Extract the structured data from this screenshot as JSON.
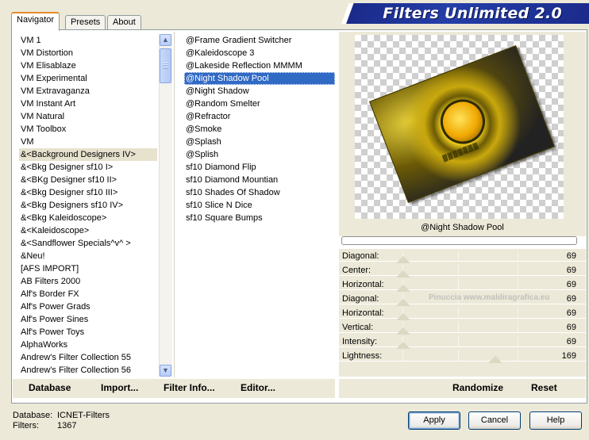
{
  "app_title": "Filters Unlimited 2.0",
  "tabs": [
    {
      "label": "Navigator",
      "active": true
    },
    {
      "label": "Presets",
      "active": false
    },
    {
      "label": "About",
      "active": false
    }
  ],
  "categories": [
    {
      "label": "VM 1"
    },
    {
      "label": "VM Distortion"
    },
    {
      "label": "VM Elisablaze"
    },
    {
      "label": "VM Experimental"
    },
    {
      "label": "VM Extravaganza"
    },
    {
      "label": "VM Instant Art"
    },
    {
      "label": "VM Natural"
    },
    {
      "label": "VM Toolbox"
    },
    {
      "label": "VM"
    },
    {
      "label": "&<Background Designers IV>",
      "selected": true
    },
    {
      "label": "&<Bkg Designer sf10 I>"
    },
    {
      "label": "&<BKg Designer sf10 II>"
    },
    {
      "label": "&<Bkg Designer sf10 III>"
    },
    {
      "label": "&<Bkg Designers sf10 IV>"
    },
    {
      "label": "&<Bkg Kaleidoscope>"
    },
    {
      "label": "&<Kaleidoscope>"
    },
    {
      "label": "&<Sandflower Specials^v^ >"
    },
    {
      "label": "&Neu!"
    },
    {
      "label": "[AFS IMPORT]"
    },
    {
      "label": "AB Filters 2000"
    },
    {
      "label": "Alf's Border FX"
    },
    {
      "label": "Alf's Power Grads"
    },
    {
      "label": "Alf's Power Sines"
    },
    {
      "label": "Alf's Power Toys"
    },
    {
      "label": "AlphaWorks"
    },
    {
      "label": "Andrew's Filter Collection 55"
    },
    {
      "label": "Andrew's Filter Collection 56"
    }
  ],
  "filters": [
    {
      "label": "@Frame Gradient Switcher"
    },
    {
      "label": "@Kaleidoscope 3"
    },
    {
      "label": "@Lakeside Reflection MMMM"
    },
    {
      "label": "@Night Shadow Pool",
      "selected": true
    },
    {
      "label": "@Night Shadow"
    },
    {
      "label": "@Random Smelter"
    },
    {
      "label": "@Refractor"
    },
    {
      "label": "@Smoke"
    },
    {
      "label": "@Splash"
    },
    {
      "label": "@Splish"
    },
    {
      "label": "sf10 Diamond Flip"
    },
    {
      "label": "sf10 Diamond Mountian"
    },
    {
      "label": "sf10 Shades Of Shadow"
    },
    {
      "label": "sf10 Slice N Dice"
    },
    {
      "label": "sf10 Square Bumps"
    }
  ],
  "preview": {
    "filter_name": "@Night Shadow Pool",
    "image_text": "▓▓▓▓▓▓▓",
    "progress": 0
  },
  "parameters": [
    {
      "label": "Diagonal:",
      "value": "69"
    },
    {
      "label": "Center:",
      "value": "69"
    },
    {
      "label": "Horizontal:",
      "value": "69"
    },
    {
      "label": "Diagonal:",
      "value": "69"
    },
    {
      "label": "Horizontal:",
      "value": "69"
    },
    {
      "label": "Vertical:",
      "value": "69"
    },
    {
      "label": "Intensity:",
      "value": "69"
    },
    {
      "label": "Lightness:",
      "value": "169"
    }
  ],
  "watermark": "Pinuccia www.maldiragrafica.eu",
  "left_buttons": {
    "database": "Database",
    "import": "Import...",
    "filter_info": "Filter Info...",
    "editor": "Editor..."
  },
  "right_buttons": {
    "randomize": "Randomize",
    "reset": "Reset"
  },
  "status": {
    "database_label": "Database:",
    "database_value": "ICNET-Filters",
    "filters_label": "Filters:",
    "filters_value": "1367"
  },
  "dialog_buttons": {
    "apply": "Apply",
    "cancel": "Cancel",
    "help": "Help"
  },
  "colors": {
    "selection": "#316ac5",
    "banner": "#243fa8",
    "tab_accent": "#e68b2c",
    "window_bg": "#ece9d8"
  }
}
